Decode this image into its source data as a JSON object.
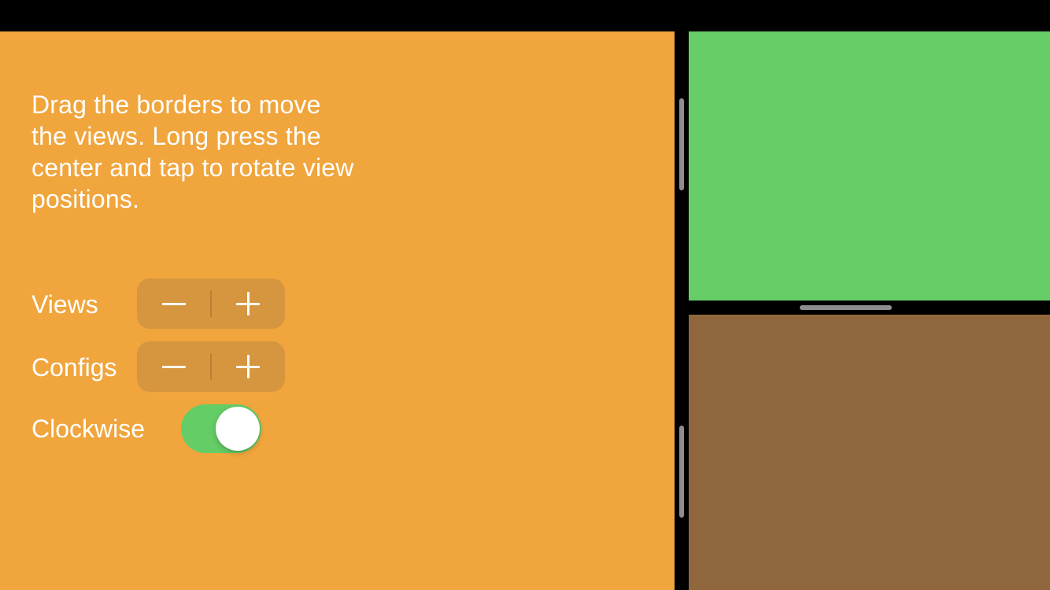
{
  "colors": {
    "background": "#000000",
    "left_pane": "#F0A53D",
    "top_right_pane": "#67CD67",
    "bottom_right_pane": "#90673C",
    "stepper_bg": "#D6963F",
    "toggle_on": "#65CD65",
    "divider_handle": "#8E8E8E"
  },
  "instructions": "Drag the borders to move the views. Long press the center and tap to rotate view positions.",
  "controls": {
    "views": {
      "label": "Views",
      "minus_icon": "minus-icon",
      "plus_icon": "plus-icon"
    },
    "configs": {
      "label": "Configs",
      "minus_icon": "minus-icon",
      "plus_icon": "plus-icon"
    },
    "clockwise": {
      "label": "Clockwise",
      "on": true
    }
  }
}
